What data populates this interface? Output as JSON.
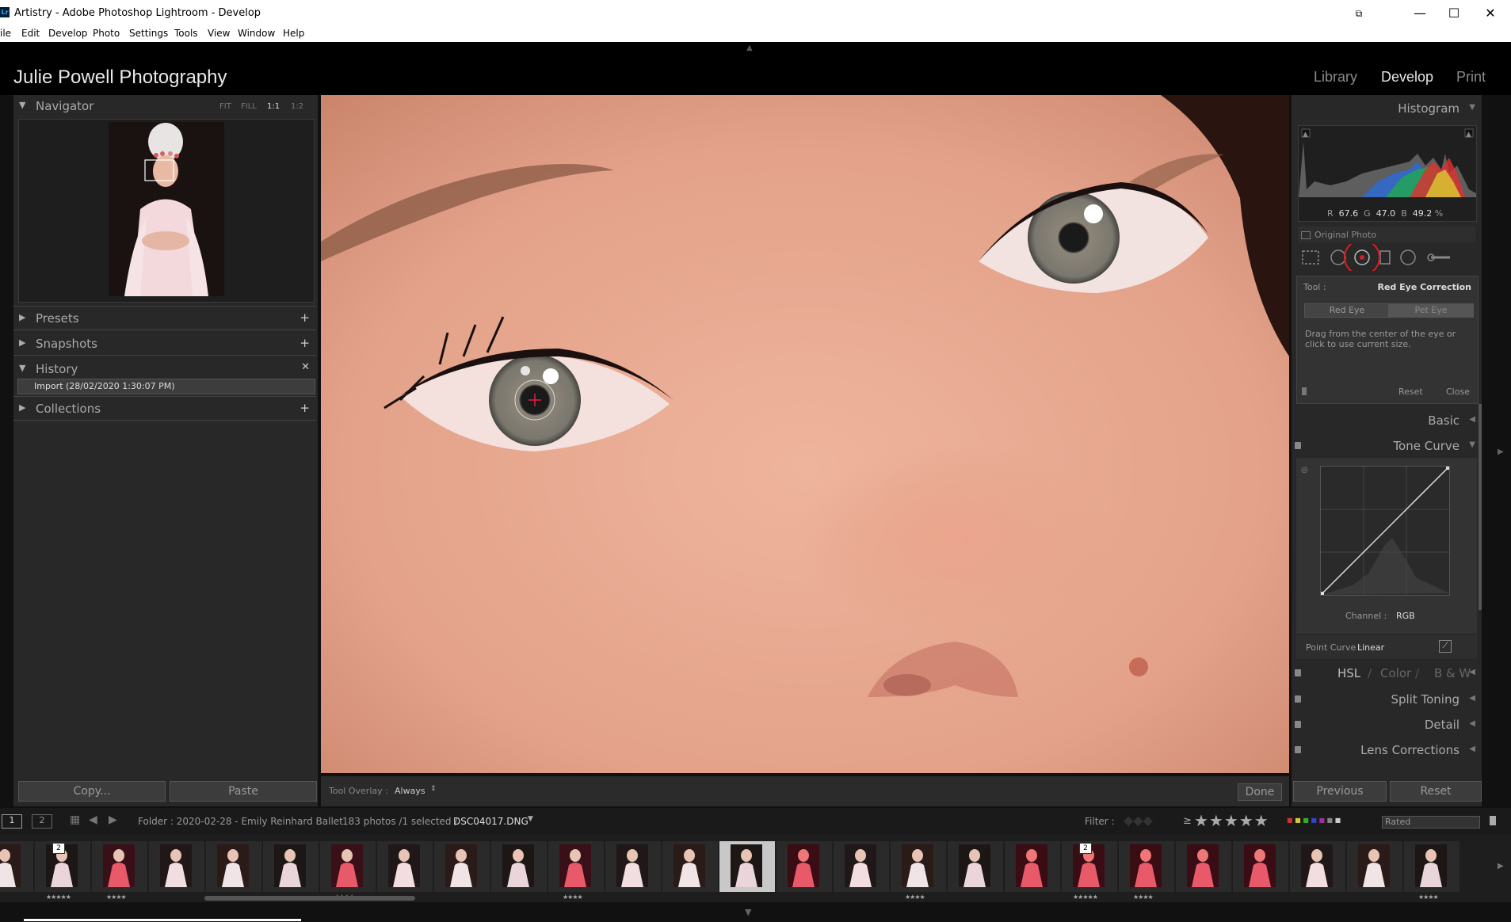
{
  "window": {
    "title": "Artistry - Adobe Photoshop Lightroom - Develop",
    "app_icon": "Lr"
  },
  "menu": [
    "ile",
    "Edit",
    "Develop",
    "Photo",
    "Settings",
    "Tools",
    "View",
    "Window",
    "Help"
  ],
  "identity": {
    "brand": "Julie Powell Photography",
    "modules": [
      "Library",
      "Develop",
      "Print"
    ],
    "active_module": "Develop"
  },
  "left_panel": {
    "navigator": {
      "label": "Navigator",
      "options": [
        "FIT",
        "FILL",
        "1:1",
        "1:2"
      ],
      "active_option": "1:1"
    },
    "presets": "Presets",
    "snapshots": "Snapshots",
    "history": {
      "label": "History",
      "items": [
        "Import (28/02/2020 1:30:07 PM)"
      ]
    },
    "collections": "Collections",
    "copy_label": "Copy...",
    "paste_label": "Paste"
  },
  "toolbar": {
    "overlay_label": "Tool Overlay :",
    "overlay_value": "Always",
    "done_label": "Done"
  },
  "right_panel": {
    "histogram": {
      "label": "Histogram",
      "readout": {
        "r_label": "R",
        "r": "67.6",
        "g_label": "G",
        "g": "47.0",
        "b_label": "B",
        "b": "49.2",
        "unit": "%"
      },
      "original_photo": "Original Photo"
    },
    "tool": {
      "tool_label": "Tool :",
      "tool_name": "Red Eye Correction",
      "modes": [
        "Red Eye",
        "Pet Eye"
      ],
      "hint": "Drag from the center of the eye or click to use current size.",
      "reset": "Reset",
      "close": "Close"
    },
    "sections": {
      "basic": "Basic",
      "tone_curve": "Tone Curve",
      "channel_label": "Channel :",
      "channel_value": "RGB",
      "point_curve_label": "Point Curve :",
      "point_curve_value": "Linear",
      "hsl": "HSL",
      "color": "Color",
      "bw": "B & W",
      "split_toning": "Split Toning",
      "detail": "Detail",
      "lens_corrections": "Lens Corrections"
    },
    "previous_label": "Previous",
    "reset_label": "Reset"
  },
  "filmstrip": {
    "screen1": "1",
    "screen2": "2",
    "folder": "Folder : 2020-02-28 - Emily Reinhard Ballet",
    "count": "183 photos /1 selected /",
    "filename": "DSC04017.DNG",
    "filter_label": "Filter :",
    "gte": "≥",
    "stars": "★★★★★",
    "rated": "Rated",
    "badge": "2",
    "thumb_stars": [
      "★★★★★",
      "★★★★",
      "",
      "",
      "",
      "★★★★",
      "",
      "",
      "",
      "★★★★",
      "",
      "",
      "",
      "",
      "",
      "★★★★",
      "",
      "",
      "★★★★★",
      "★★★★",
      "",
      "",
      "",
      "",
      "★★★★"
    ]
  },
  "colors": {
    "accent_red": "#d42020",
    "panel": "#282828"
  }
}
